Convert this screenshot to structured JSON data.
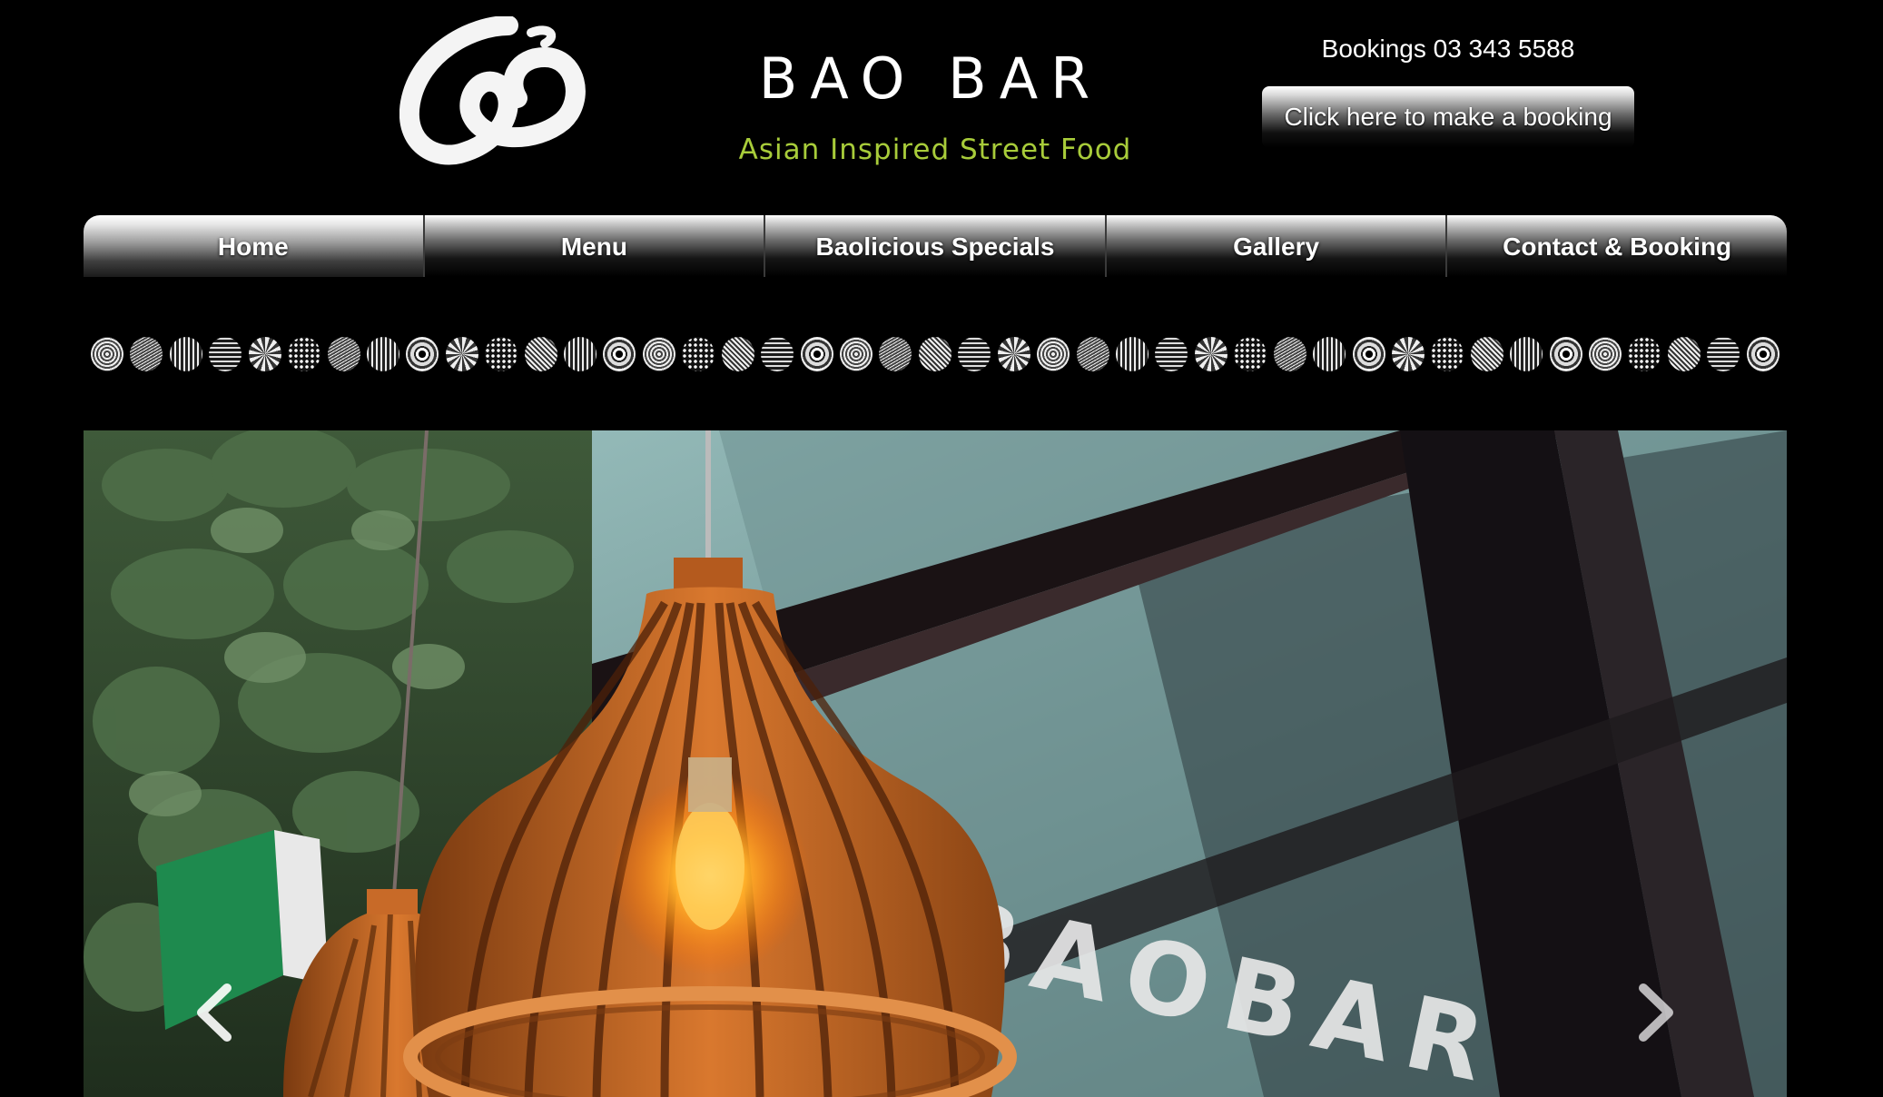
{
  "header": {
    "brand_title": "BAO BAR",
    "tagline": "Asian Inspired Street Food",
    "bookings_phone": "Bookings 03 343 5588",
    "booking_button_label": "Click here to make a booking",
    "logo_icon": "brush-stroke-logo-icon",
    "tagline_color": "#a8cc3a"
  },
  "nav": {
    "items": [
      {
        "label": "Home",
        "active": true
      },
      {
        "label": "Menu",
        "active": false
      },
      {
        "label": "Baolicious Specials",
        "active": false
      },
      {
        "label": "Gallery",
        "active": false
      },
      {
        "label": "Contact & Booking",
        "active": false
      }
    ]
  },
  "decor": {
    "dot_count": 43
  },
  "hero": {
    "window_lettering": "BAOBAR",
    "prev_icon": "chevron-left-icon",
    "next_icon": "chevron-right-icon"
  }
}
